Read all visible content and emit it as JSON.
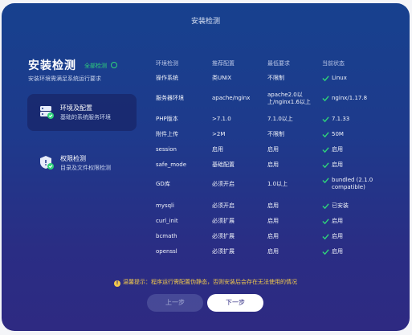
{
  "window": {
    "title": "安装检测"
  },
  "header": {
    "heading": "安装检测",
    "status_label": "全部检测",
    "description": "安装环境需满足系统运行要求"
  },
  "sidebar": {
    "items": [
      {
        "title": "环境及配置",
        "subtitle": "基础的系统服务环境",
        "icon": "server-check-icon",
        "active": true
      },
      {
        "title": "权限检测",
        "subtitle": "目录及文件权限检测",
        "icon": "shield-check-icon",
        "active": false
      }
    ]
  },
  "table": {
    "headers": [
      "环境检测",
      "推荐配置",
      "最低要求",
      "当前状态"
    ],
    "rows": [
      {
        "name": "操作系统",
        "recommended": "类UNIX",
        "minimum": "不限制",
        "current": "Linux"
      },
      {
        "name": "服务器环境",
        "recommended": "apache/nginx",
        "minimum": "apache2.0以上/nginx1.6以上",
        "current": "nginx/1.17.8"
      },
      {
        "name": "PHP版本",
        "recommended": ">7.1.0",
        "minimum": "7.1.0以上",
        "current": "7.1.33"
      },
      {
        "name": "附件上传",
        "recommended": ">2M",
        "minimum": "不限制",
        "current": "50M"
      },
      {
        "name": "session",
        "recommended": "启用",
        "minimum": "启用",
        "current": "启用"
      },
      {
        "name": "safe_mode",
        "recommended": "基础配置",
        "minimum": "启用",
        "current": "启用"
      },
      {
        "name": "GD库",
        "recommended": "必须开启",
        "minimum": "1.0以上",
        "current": "bundled (2.1.0 compatible)"
      },
      {
        "name": "mysqli",
        "recommended": "必须开启",
        "minimum": "启用",
        "current": "已安装"
      },
      {
        "name": "curl_init",
        "recommended": "必须扩展",
        "minimum": "启用",
        "current": "启用"
      },
      {
        "name": "bcmath",
        "recommended": "必须扩展",
        "minimum": "启用",
        "current": "启用"
      },
      {
        "name": "openssl",
        "recommended": "必须扩展",
        "minimum": "启用",
        "current": "启用"
      }
    ]
  },
  "notice": {
    "text": "温馨提示：程序运行需配置伪静态，否则安装后会存在无法使用的情况"
  },
  "buttons": {
    "prev_label": "上一步",
    "next_label": "下一步"
  },
  "colors": {
    "accent_green": "#2fd27a",
    "warning": "#f2c94c",
    "background_top": "#17418e",
    "background_bottom": "#2e2a82"
  }
}
